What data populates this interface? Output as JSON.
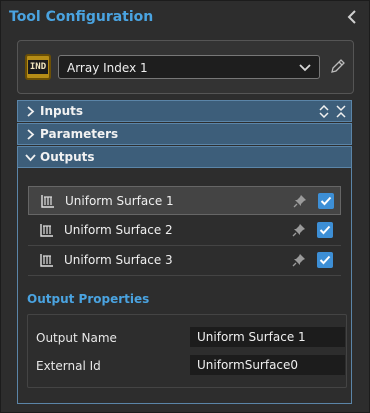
{
  "header": {
    "title": "Tool Configuration",
    "collapse_icon": "chevron-left-icon"
  },
  "tool": {
    "badge": "IND",
    "selected": "Array Index 1"
  },
  "sections": [
    {
      "label": "Inputs",
      "expanded": false
    },
    {
      "label": "Parameters",
      "expanded": false
    },
    {
      "label": "Outputs",
      "expanded": true
    }
  ],
  "outputs": [
    {
      "label": "Uniform Surface 1",
      "checked": true,
      "selected": true
    },
    {
      "label": "Uniform Surface 2",
      "checked": true,
      "selected": false
    },
    {
      "label": "Uniform Surface 3",
      "checked": true,
      "selected": false
    }
  ],
  "output_properties": {
    "title": "Output Properties",
    "fields": [
      {
        "label": "Output Name",
        "value": "Uniform Surface 1"
      },
      {
        "label": "External Id",
        "value": "UniformSurface0"
      }
    ]
  },
  "colors": {
    "accent": "#4aa3e0",
    "section_bg": "#3d5e7a",
    "checkbox": "#3d8fd6",
    "badge": "#b68d17"
  }
}
